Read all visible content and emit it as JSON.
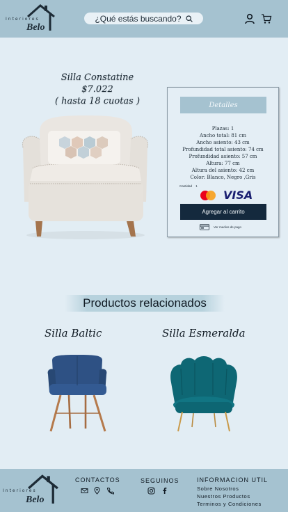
{
  "header": {
    "logo_line1": "Interiores",
    "logo_line2": "Belo",
    "search_placeholder": "¿Qué estás buscando?",
    "icons": [
      "search-icon",
      "user-icon",
      "cart-icon"
    ]
  },
  "product": {
    "name": "Silla Constatine",
    "price": "$7.022",
    "installments": "( hasta 18 cuotas )",
    "details_label": "Detalles",
    "specs": [
      "Plazas: 1",
      "Ancho total: 81 cm",
      "Ancho asiento: 43 cm",
      "Profundidad total asiento: 74 cm",
      "Profundidad asiento: 57 cm",
      "Altura: 77 cm",
      "Altura del asiento: 42 cm",
      "Color: Blanco, Negro ,Gris"
    ],
    "quantity_label": "Cantidad",
    "quantity_value": "1",
    "visa_label": "VISA",
    "add_to_cart_label": "Agregar al carrito",
    "payment_link_label": "Ver medios de pago"
  },
  "related": {
    "title": "Productos relacionados",
    "items": [
      {
        "name": "Silla Baltic"
      },
      {
        "name": "Silla Esmeralda"
      }
    ]
  },
  "footer": {
    "logo_line1": "Interiores",
    "logo_line2": "Belo",
    "contacts_title": "CONTACTOS",
    "follow_title": "SEGUINOS",
    "info_title": "INFORMACION UTIL",
    "info_links": [
      "Sobre Nosotros",
      "Nuestros Productos",
      "Terminos y Condiciones"
    ]
  },
  "colors": {
    "header_bg": "#a5c2d0",
    "page_bg": "#e2edf4",
    "primary_button": "#14293d",
    "secondary_button": "#a5c2d0"
  }
}
